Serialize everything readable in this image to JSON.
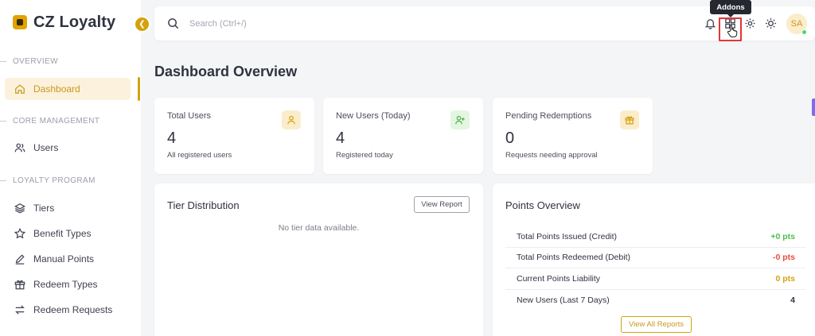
{
  "brand": {
    "name": "CZ Loyalty"
  },
  "sidebar": {
    "sections": [
      {
        "title": "OVERVIEW"
      },
      {
        "title": "CORE MANAGEMENT"
      },
      {
        "title": "LOYALTY PROGRAM"
      }
    ],
    "items": [
      {
        "label": "Dashboard",
        "icon": "home-icon",
        "active": true
      },
      {
        "label": "Users",
        "icon": "users-icon"
      },
      {
        "label": "Tiers",
        "icon": "layers-icon"
      },
      {
        "label": "Benefit Types",
        "icon": "star-icon"
      },
      {
        "label": "Manual Points",
        "icon": "pencil-icon"
      },
      {
        "label": "Redeem Types",
        "icon": "gift-icon"
      },
      {
        "label": "Redeem Requests",
        "icon": "swap-icon"
      }
    ]
  },
  "topbar": {
    "search_placeholder": "Search (Ctrl+/)",
    "tooltip": "Addons",
    "avatar_initials": "SA"
  },
  "page": {
    "title": "Dashboard Overview"
  },
  "stats": [
    {
      "label": "Total Users",
      "value": "4",
      "sub": "All registered users",
      "icon": "user-icon",
      "icon_bg": "#fbeccb",
      "icon_color": "#d4a20e"
    },
    {
      "label": "New Users (Today)",
      "value": "4",
      "sub": "Registered today",
      "icon": "user-plus-icon",
      "icon_bg": "#e3f6df",
      "icon_color": "#4caf50"
    },
    {
      "label": "Pending Redemptions",
      "value": "0",
      "sub": "Requests needing approval",
      "icon": "gift-icon",
      "icon_bg": "#fbeccb",
      "icon_color": "#d4a20e"
    }
  ],
  "tier_card": {
    "title": "Tier Distribution",
    "button": "View Report",
    "empty": "No tier data available."
  },
  "points_card": {
    "title": "Points Overview",
    "rows": [
      {
        "label": "Total Points Issued (Credit)",
        "value": "+0 pts",
        "color": "#4cc04a"
      },
      {
        "label": "Total Points Redeemed (Debit)",
        "value": "-0 pts",
        "color": "#e84c3d"
      },
      {
        "label": "Current Points Liability",
        "value": "0 pts",
        "color": "#d4a20e"
      },
      {
        "label": "New Users (Last 7 Days)",
        "value": "4",
        "color": "#2f3340"
      }
    ],
    "button": "View All Reports"
  },
  "colors": {
    "accent": "#d4a20e",
    "highlight": "#e23636"
  }
}
